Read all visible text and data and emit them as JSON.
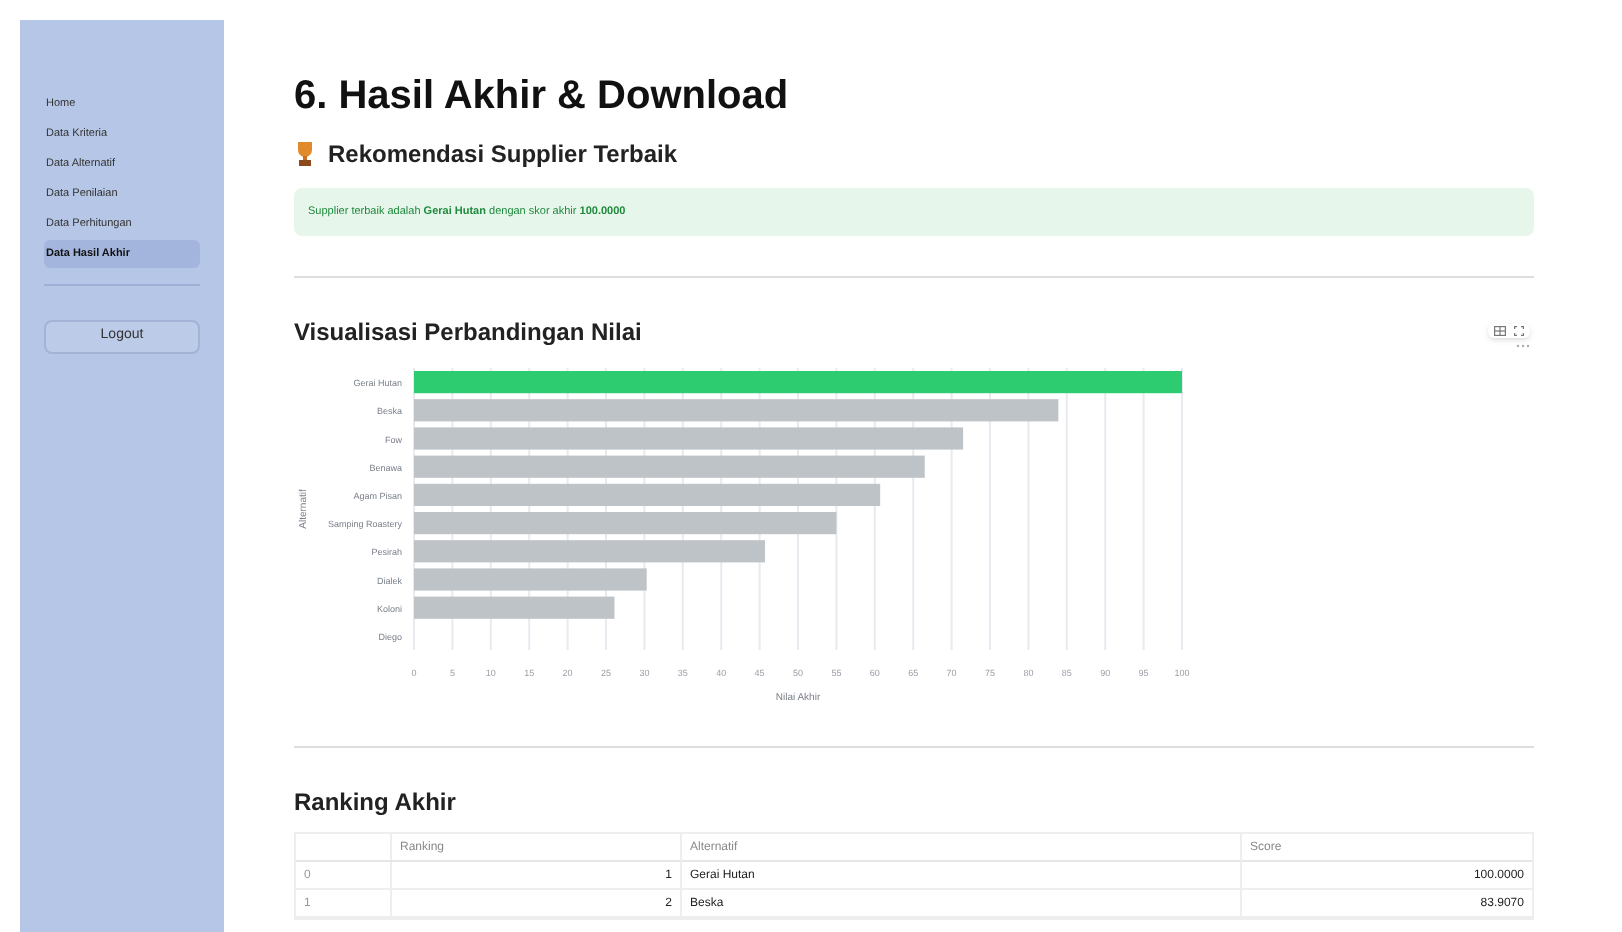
{
  "sidebar": {
    "items": [
      {
        "label": "Home",
        "selected": false
      },
      {
        "label": "Data Kriteria",
        "selected": false
      },
      {
        "label": "Data Alternatif",
        "selected": false
      },
      {
        "label": "Data Penilaian",
        "selected": false
      },
      {
        "label": "Data Perhitungan",
        "selected": false
      },
      {
        "label": "Data Hasil Akhir",
        "selected": true
      }
    ],
    "logout": "Logout"
  },
  "title": "6. Hasil Akhir & Download",
  "recommendation": {
    "heading": "Rekomendasi Supplier Terbaik",
    "message": "Supplier terbaik adalah **Gerai Hutan** dengan skor akhir **100.0000**"
  },
  "chart_section": {
    "heading": "Visualisasi Perbandingan Nilai",
    "chart_data": {
      "type": "bar",
      "orientation": "horizontal",
      "xlabel": "Nilai Akhir",
      "ylabel": "Alternatif",
      "categories": [
        "Gerai Hutan",
        "Beska",
        "Fow",
        "Benawa",
        "Agam Pisan",
        "Samping Roastery",
        "Pesirah",
        "Dialek",
        "Koloni",
        "Diego"
      ],
      "series": [
        {
          "color": "#2ecc71",
          "values": [
            100,
            null,
            null,
            null,
            null,
            null,
            null,
            null,
            null,
            null
          ]
        },
        {
          "color": "#bdc3c7",
          "values": [
            null,
            83.9,
            71.5,
            66.5,
            60.7,
            55,
            45.7,
            30.3,
            26.1,
            0
          ]
        }
      ],
      "grid": true,
      "xlim": [
        0,
        100
      ],
      "xticks": [
        0,
        5,
        10,
        15,
        20,
        25,
        30,
        35,
        40,
        45,
        50,
        55,
        60,
        65,
        70,
        75,
        80,
        85,
        90,
        95,
        100
      ]
    }
  },
  "ranking": {
    "heading": "Ranking Akhir",
    "columns": [
      "Ranking",
      "Alternatif",
      "Score"
    ],
    "rows": [
      {
        "index": "0",
        "ranking": "1",
        "alternatif": "Gerai Hutan",
        "score": "100.0000"
      },
      {
        "index": "1",
        "ranking": "2",
        "alternatif": "Beska",
        "score": "83.9070"
      }
    ]
  }
}
